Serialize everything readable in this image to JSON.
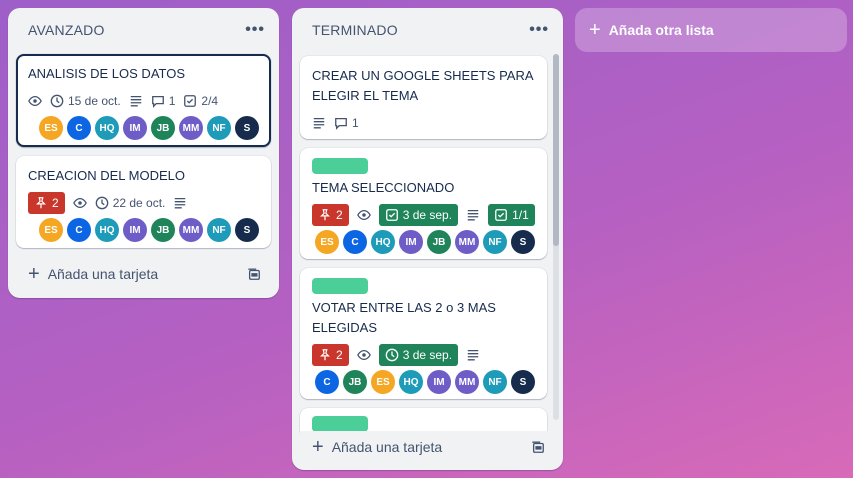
{
  "lists": [
    {
      "title": "AVANZADO",
      "menu": "•••",
      "cards": [
        {
          "title": "ANALISIS DE LOS DATOS",
          "date": "15 de oct.",
          "comments": "1",
          "checklist": "2/4",
          "members": [
            "ES",
            "C",
            "HQ",
            "IM",
            "JB",
            "MM",
            "NF",
            "S"
          ]
        },
        {
          "title": "CREACION DEL MODELO",
          "priority": "2",
          "date": "22 de oct.",
          "members": [
            "ES",
            "C",
            "HQ",
            "IM",
            "JB",
            "MM",
            "NF",
            "S"
          ]
        }
      ],
      "add_card": "Añada una tarjeta"
    },
    {
      "title": "TERMINADO",
      "menu": "•••",
      "cards": [
        {
          "title": "CREAR UN GOOGLE SHEETS PARA ELEGIR EL TEMA",
          "comments": "1"
        },
        {
          "title": "TEMA SELECCIONADO",
          "priority": "2",
          "date": "3 de sep.",
          "checklist": "1/1",
          "members": [
            "ES",
            "C",
            "HQ",
            "IM",
            "JB",
            "MM",
            "NF",
            "S"
          ]
        },
        {
          "title": "VOTAR ENTRE LAS 2 o 3 MAS ELEGIDAS",
          "priority": "2",
          "date": "3 de sep.",
          "members": [
            "C",
            "JB",
            "ES",
            "HQ",
            "IM",
            "MM",
            "NF",
            "S"
          ]
        }
      ],
      "add_card": "Añada una tarjeta"
    }
  ],
  "add_list": "Añada otra lista",
  "colors": {
    "ES": "#f5a623",
    "C": "#0c66e4",
    "HQ": "#1d9bb8",
    "IM": "#6e5dc6",
    "JB": "#1f845a",
    "MM": "#6e5dc6",
    "NF": "#1d9bb8",
    "S": "#172b4d",
    "label_green": "#4bce97"
  }
}
